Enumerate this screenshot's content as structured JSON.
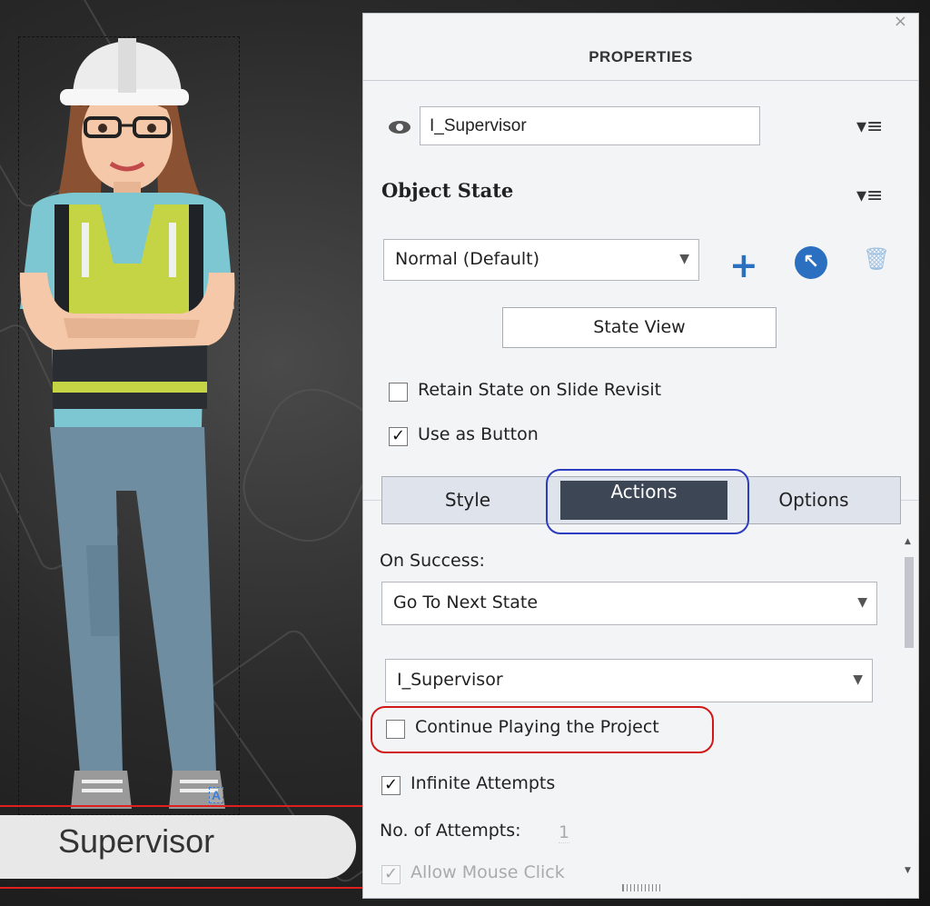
{
  "canvas": {
    "caption": "Supervisor",
    "selection_badge": "A"
  },
  "panel": {
    "close_glyph": "×",
    "title": "PROPERTIES",
    "object_name": "I_Supervisor",
    "menu_glyph": "▾≡",
    "object_state": {
      "heading": "Object State",
      "selected_state": "Normal (Default)",
      "add_glyph": "+",
      "goto_glyph": "↖",
      "delete_glyph": "🗑",
      "state_view_label": "State View"
    },
    "checkboxes": {
      "retain_state": {
        "label": "Retain State on Slide Revisit",
        "checked": false
      },
      "use_as_button": {
        "label": "Use as Button",
        "checked": true
      }
    },
    "tabs": [
      {
        "label": "Style",
        "active": false
      },
      {
        "label": "Actions",
        "active": true
      },
      {
        "label": "Options",
        "active": false
      }
    ],
    "actions": {
      "on_success_label": "On Success:",
      "on_success_value": "Go To Next State",
      "target_value": "I_Supervisor",
      "continue_playing": {
        "label": "Continue Playing the Project",
        "checked": false
      },
      "infinite_attempts": {
        "label": "Infinite Attempts",
        "checked": true
      },
      "attempts_label": "No. of Attempts:",
      "attempts_value": "1",
      "allow_mouse_click": {
        "label": "Allow Mouse Click",
        "checked": true
      }
    }
  },
  "colors": {
    "accent_blue": "#2a6fc0",
    "tab_active": "#3d4654",
    "highlight_blue": "#2c3cc0",
    "highlight_red": "#d01818"
  }
}
